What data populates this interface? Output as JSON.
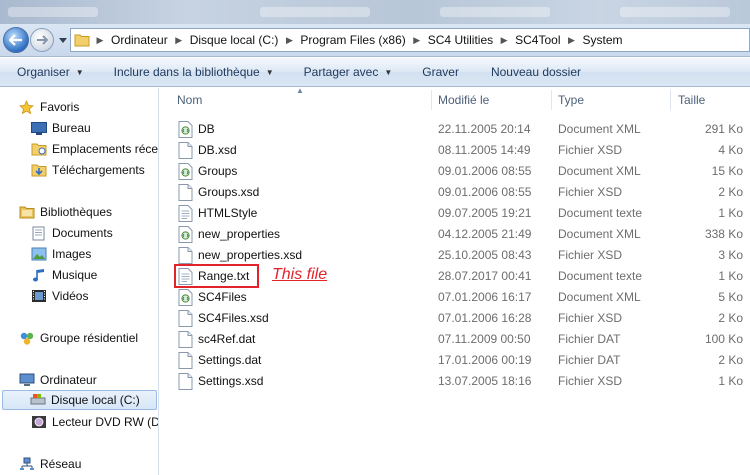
{
  "window": {
    "address": {
      "crumbs": [
        "Ordinateur",
        "Disque local (C:)",
        "Program Files (x86)",
        "SC4 Utilities",
        "SC4Tool",
        "System"
      ]
    },
    "toolbar": {
      "organize": "Organiser",
      "include_library": "Inclure dans la bibliothèque",
      "share_with": "Partager avec",
      "burn": "Graver",
      "new_folder": "Nouveau dossier"
    }
  },
  "navpane": {
    "favorites": "Favoris",
    "desktop": "Bureau",
    "recent_places": "Emplacements récen",
    "downloads": "Téléchargements",
    "libraries": "Bibliothèques",
    "documents": "Documents",
    "images": "Images",
    "music": "Musique",
    "videos": "Vidéos",
    "homegroup": "Groupe résidentiel",
    "computer": "Ordinateur",
    "local_disk": "Disque local (C:)",
    "dvd_drive": "Lecteur DVD RW (D:)",
    "network": "Réseau"
  },
  "columns": {
    "name": "Nom",
    "modified": "Modifié le",
    "type": "Type",
    "size": "Taille"
  },
  "files": [
    {
      "name": "DB",
      "modified": "22.11.2005 20:14",
      "type": "Document XML",
      "size": "291 Ko",
      "icon": "xml"
    },
    {
      "name": "DB.xsd",
      "modified": "08.11.2005 14:49",
      "type": "Fichier XSD",
      "size": "4 Ko",
      "icon": "file"
    },
    {
      "name": "Groups",
      "modified": "09.01.2006 08:55",
      "type": "Document XML",
      "size": "15 Ko",
      "icon": "xml"
    },
    {
      "name": "Groups.xsd",
      "modified": "09.01.2006 08:55",
      "type": "Fichier XSD",
      "size": "2 Ko",
      "icon": "file"
    },
    {
      "name": "HTMLStyle",
      "modified": "09.07.2005 19:21",
      "type": "Document texte",
      "size": "1 Ko",
      "icon": "text"
    },
    {
      "name": "new_properties",
      "modified": "04.12.2005 21:49",
      "type": "Document XML",
      "size": "338 Ko",
      "icon": "xml"
    },
    {
      "name": "new_properties.xsd",
      "modified": "25.10.2005 08:43",
      "type": "Fichier XSD",
      "size": "3 Ko",
      "icon": "file"
    },
    {
      "name": "Range.txt",
      "modified": "28.07.2017 00:41",
      "type": "Document texte",
      "size": "1 Ko",
      "icon": "text"
    },
    {
      "name": "SC4Files",
      "modified": "07.01.2006 16:17",
      "type": "Document XML",
      "size": "5 Ko",
      "icon": "xml"
    },
    {
      "name": "SC4Files.xsd",
      "modified": "07.01.2006 16:28",
      "type": "Fichier XSD",
      "size": "2 Ko",
      "icon": "file"
    },
    {
      "name": "sc4Ref.dat",
      "modified": "07.11.2009 00:50",
      "type": "Fichier DAT",
      "size": "100 Ko",
      "icon": "file"
    },
    {
      "name": "Settings.dat",
      "modified": "17.01.2006 00:19",
      "type": "Fichier DAT",
      "size": "2 Ko",
      "icon": "file"
    },
    {
      "name": "Settings.xsd",
      "modified": "13.07.2005 18:16",
      "type": "Fichier XSD",
      "size": "1 Ko",
      "icon": "file"
    }
  ],
  "annotation": {
    "text": "This file",
    "color": "#e2232a"
  },
  "colors": {
    "accent": "#2e6fc4",
    "toolbar_text": "#1e395b",
    "secondary_text": "#6d6d6d",
    "header_text": "#4c607a"
  }
}
